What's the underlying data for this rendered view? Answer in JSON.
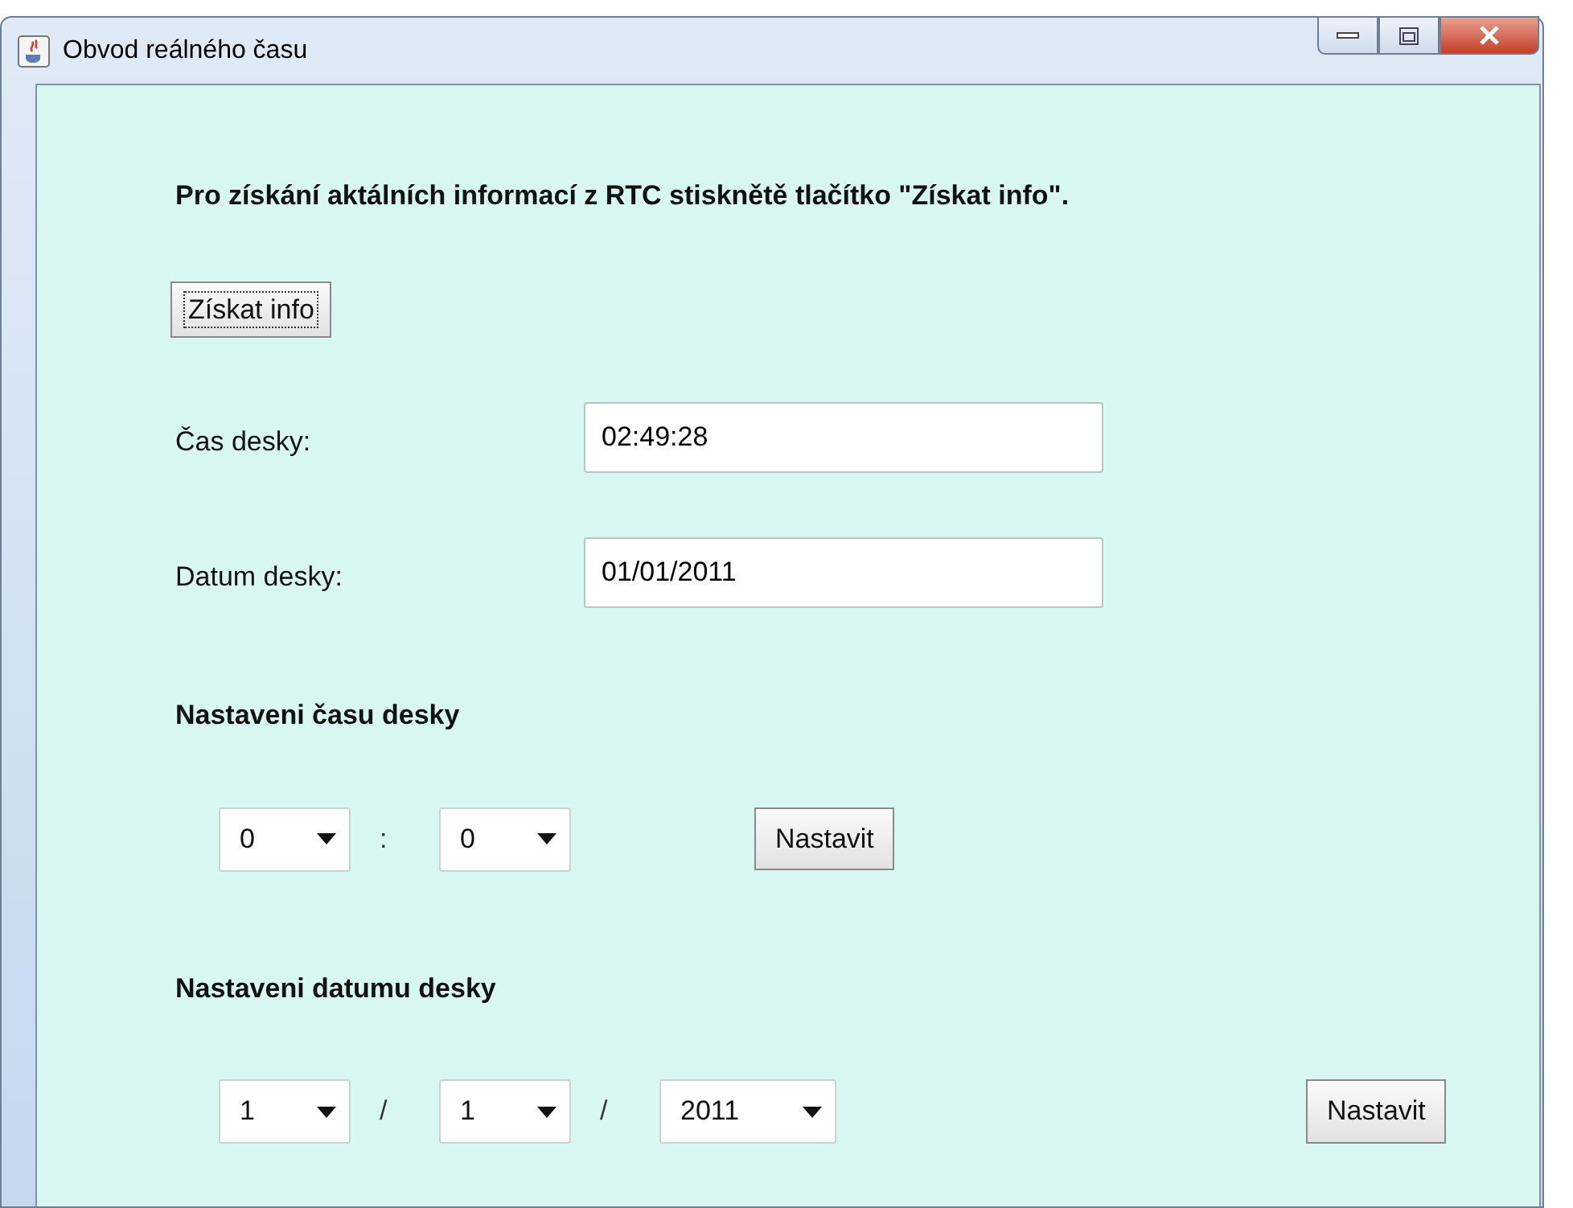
{
  "window": {
    "title": "Obvod reálného času"
  },
  "instruction": "Pro získání aktálních informací z RTC stisknětě tlačítko \"Získat info\".",
  "get_info_button": {
    "label": "Získat info",
    "focused": true
  },
  "fields": [
    {
      "label": "Čas desky:",
      "value": "02:49:28"
    },
    {
      "label": "Datum desky:",
      "value": "01/01/2011"
    }
  ],
  "time_section": {
    "heading": "Nastaveni času desky",
    "combos": [
      {
        "value": "0"
      },
      {
        "value": "0"
      }
    ],
    "separators": [
      ":"
    ],
    "button": "Nastavit"
  },
  "date_section": {
    "heading": "Nastaveni datumu desky",
    "combos": [
      {
        "value": "1"
      },
      {
        "value": "1"
      },
      {
        "value": "2011"
      }
    ],
    "separators": [
      "/",
      "/"
    ],
    "button": "Nastavit"
  }
}
